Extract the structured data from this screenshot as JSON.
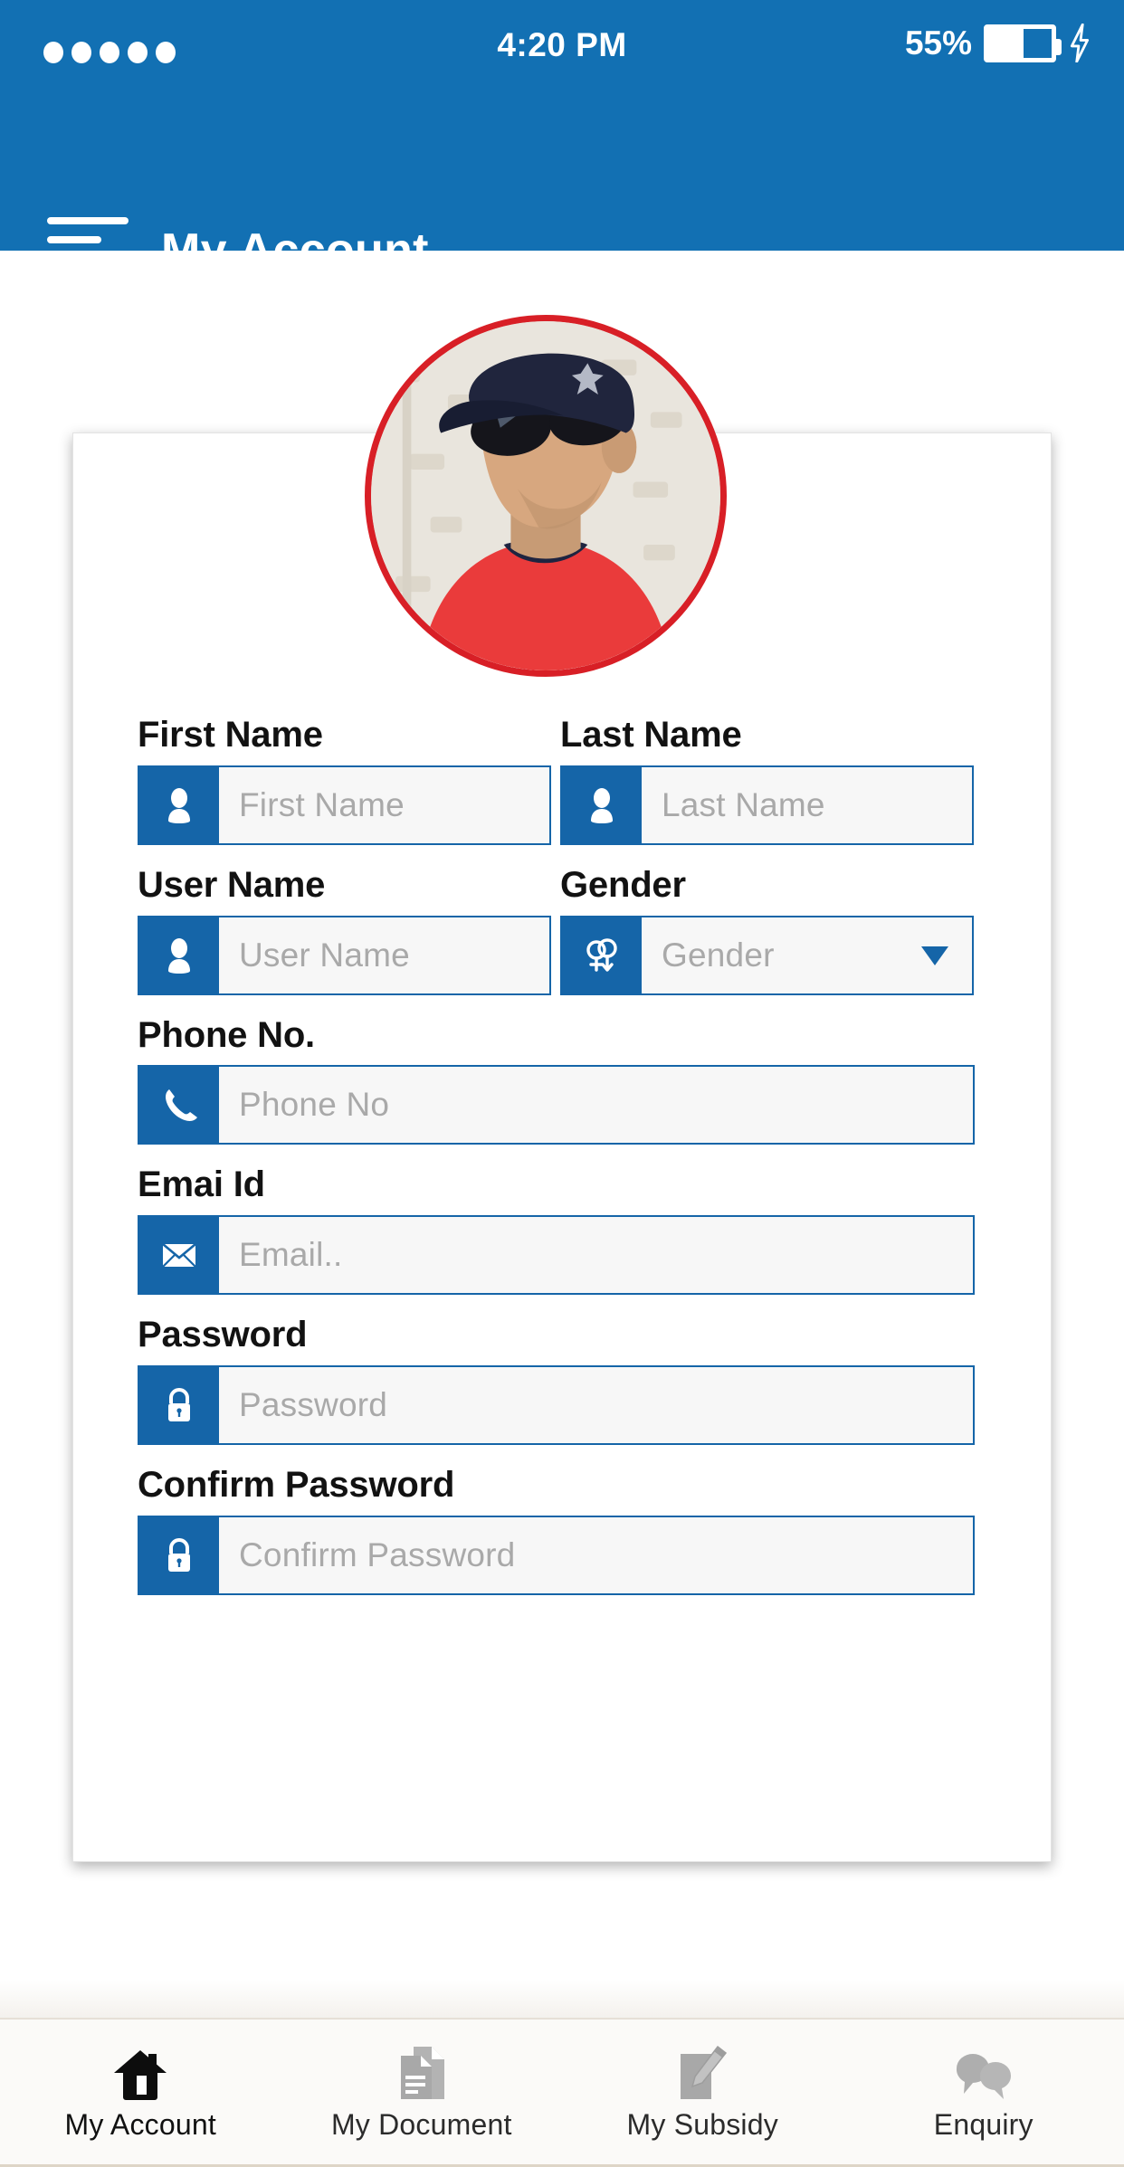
{
  "status_bar": {
    "signal_dots": 5,
    "time": "4:20 PM",
    "battery_percent": "55%",
    "battery_level": 55,
    "charging": true
  },
  "header": {
    "title": "My Account",
    "menu_icon": "hamburger-icon",
    "background_color": "#1270b3"
  },
  "profile": {
    "avatar_alt": "profile-photo",
    "avatar_border_color": "#d81f26"
  },
  "form": {
    "fields": [
      {
        "label": "First Name",
        "placeholder": "First Name",
        "icon": "person-icon",
        "type": "text",
        "value": ""
      },
      {
        "label": "Last Name",
        "placeholder": "Last Name",
        "icon": "person-icon",
        "type": "text",
        "value": ""
      },
      {
        "label": "User Name",
        "placeholder": "User Name",
        "icon": "person-icon",
        "type": "text",
        "value": ""
      },
      {
        "label": "Gender",
        "placeholder": "Gender",
        "icon": "gender-icon",
        "type": "select",
        "value": ""
      },
      {
        "label": "Phone No.",
        "placeholder": "Phone No",
        "icon": "phone-icon",
        "type": "tel",
        "value": ""
      },
      {
        "label": "Emai Id",
        "placeholder": "Email..",
        "icon": "envelope-icon",
        "type": "email",
        "value": ""
      },
      {
        "label": "Password",
        "placeholder": "Password",
        "icon": "lock-icon",
        "type": "password",
        "value": ""
      },
      {
        "label": "Confirm Password",
        "placeholder": "Confirm Password",
        "icon": "lock-icon",
        "type": "password",
        "value": ""
      }
    ],
    "accent_color": "#1565a8",
    "input_background": "#f7f7f7",
    "placeholder_color": "#a9a9a9"
  },
  "bottom_nav": {
    "items": [
      {
        "label": "My Account",
        "icon": "home-icon",
        "active": true
      },
      {
        "label": "My Document",
        "icon": "document-icon",
        "active": false
      },
      {
        "label": "My Subsidy",
        "icon": "pencil-note-icon",
        "active": false
      },
      {
        "label": "Enquiry",
        "icon": "chat-bubbles-icon",
        "active": false
      }
    ],
    "active_color": "#111111",
    "inactive_color": "#ababab"
  }
}
